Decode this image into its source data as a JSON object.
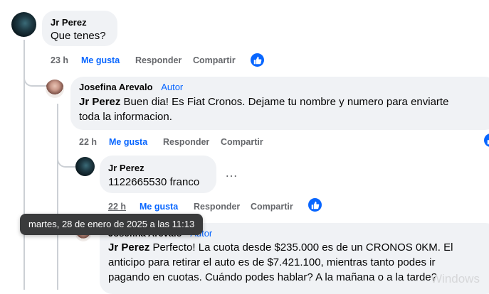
{
  "comments": [
    {
      "author": "Jr Perez",
      "text": "Que tenes?",
      "time": "23 h",
      "like_label": "Me gusta",
      "reply_label": "Responder",
      "share_label": "Compartir"
    },
    {
      "author": "Josefina Arevalo",
      "badge": "Autor",
      "mention": "Jr Perez",
      "text_line1": " Buen dia! Es Fiat Cronos. Dejame tu nombre y numero para enviarte",
      "text_line2": "toda la informacion.",
      "time": "22 h",
      "like_label": "Me gusta",
      "reply_label": "Responder",
      "share_label": "Compartir"
    },
    {
      "author": "Jr Perez",
      "text": "1122665530 franco",
      "time": "22 h",
      "like_label": "Me gusta",
      "reply_label": "Responder",
      "share_label": "Compartir",
      "more_label": "…"
    },
    {
      "author": "Josefina Arevalo",
      "badge": "Autor",
      "mention": "Jr Perez",
      "text_line1": " Perfecto! La cuota desde $235.000 es de un CRONOS 0KM. El",
      "text_line2": "anticipo para retirar el auto es de $7.421.100, mientras tanto podes ir",
      "text_line3": "pagando en cuotas. Cuándo podes hablar? A la mañana o a la tarde?"
    }
  ],
  "tooltip": "martes, 28 de enero de 2025 a las 11:13",
  "watermark": "Windows",
  "colors": {
    "accent": "#0866ff",
    "bubble": "#f0f2f5",
    "muted": "#65676b",
    "tooltip_bg": "#3a3b3c"
  },
  "icons": [
    "like-thumb-icon",
    "more-options-icon"
  ]
}
